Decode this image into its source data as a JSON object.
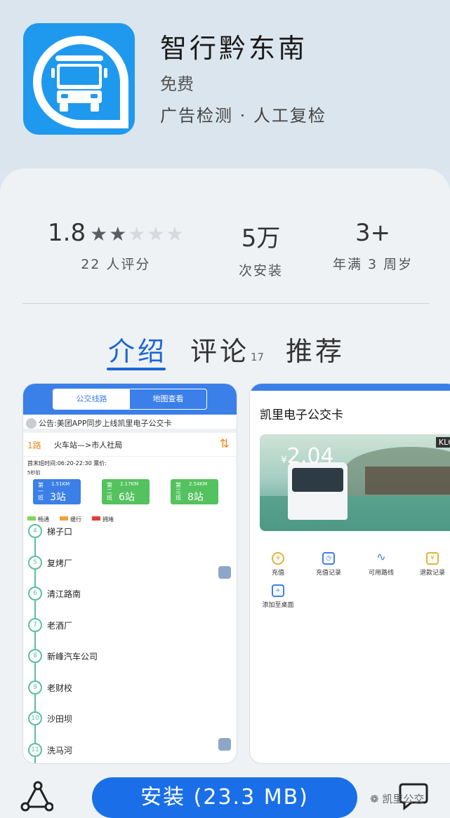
{
  "app": {
    "title": "智行黔东南",
    "price": "免费",
    "note": "广告检测 · 人工复检"
  },
  "stats": {
    "rating": "1.8",
    "rating_stars": 2,
    "rating_count": "22 人评分",
    "installs": "5万",
    "installs_label": "次安装",
    "age": "3+",
    "age_label": "年满 3 周岁"
  },
  "tabs": [
    {
      "label": "介绍",
      "active": true
    },
    {
      "label": "评论",
      "count": "17"
    },
    {
      "label": "推荐"
    }
  ],
  "screenshot1": {
    "segment": [
      "公交线路",
      "地图查看"
    ],
    "notice": "公告:美团APP同步上线凯里电子公交卡",
    "route_no": "1路",
    "route_name": "火车站—>市人社局",
    "time_info": "首末班时间:06:20-22:30 票价:",
    "ago": "5秒前",
    "buses": [
      {
        "label": "第一班",
        "km": "1.51KM",
        "stops": "3站"
      },
      {
        "label": "第二班",
        "km": "2.17KM",
        "stops": "6站"
      },
      {
        "label": "第三班",
        "km": "2.54KM",
        "stops": "8站"
      }
    ],
    "legend": [
      "畅通",
      "缓行",
      "拥堵"
    ],
    "legend_colors": [
      "#7ed957",
      "#f0a23c",
      "#e0403a"
    ],
    "stop_list": [
      {
        "no": "4",
        "name": "梯子口"
      },
      {
        "no": "5",
        "name": "复烤厂"
      },
      {
        "no": "6",
        "name": "清江路南"
      },
      {
        "no": "7",
        "name": "老酒厂"
      },
      {
        "no": "8",
        "name": "新峰汽车公司"
      },
      {
        "no": "9",
        "name": "老财校"
      },
      {
        "no": "10",
        "name": "沙田坝"
      },
      {
        "no": "11",
        "name": "洗马河"
      }
    ]
  },
  "screenshot2": {
    "title": "凯里电子公交卡",
    "card_amount": "2.04",
    "card_currency": "¥",
    "card_logo": "KLGJ",
    "actions": [
      "充值",
      "充值记录",
      "可用路线",
      "退款记录",
      "添加至桌面"
    ]
  },
  "bottom": {
    "install_label": "安装 (23.3 MB)",
    "watermark": "凯里公交"
  },
  "colors": {
    "accent": "#1a6fe8",
    "app_icon_bg": "#1f99ee"
  }
}
